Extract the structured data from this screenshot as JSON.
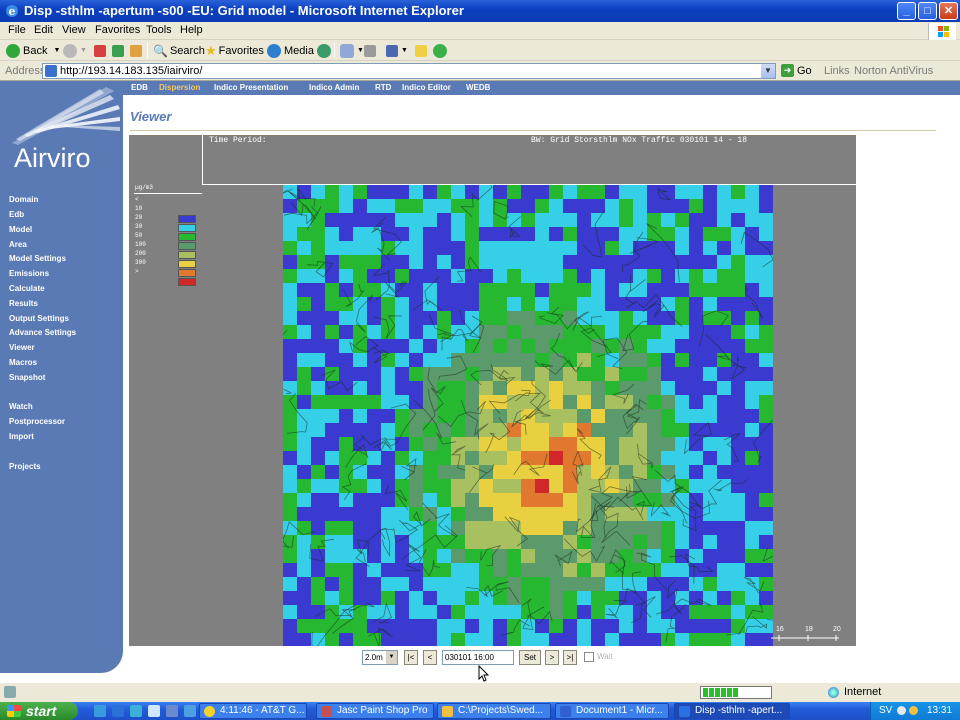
{
  "window": {
    "title": "Disp -sthlm -apertum -s00 -EU: Grid model - Microsoft Internet Explorer",
    "minimize": "_",
    "maximize": "□",
    "close": "✕"
  },
  "menu": [
    "File",
    "Edit",
    "View",
    "Favorites",
    "Tools",
    "Help"
  ],
  "toolbar": {
    "back": "Back",
    "search": "Search",
    "favorites": "Favorites",
    "media": "Media"
  },
  "address": {
    "label": "Address",
    "url": "http://193.14.183.135/iairviro/",
    "go": "Go",
    "links": "Links",
    "norton": "Norton AntiVirus"
  },
  "app": {
    "logo": "Airviro",
    "top_nav": [
      "EDB",
      "Dispersion",
      "Indico Presentation",
      "Indico Admin",
      "RTD",
      "Indico Editor",
      "WEDB"
    ],
    "active_top_nav": "Dispersion",
    "side_nav": [
      "Domain",
      "Edb",
      "Model",
      "Area",
      "Model Settings",
      "Emissions",
      "Calculate",
      "Results",
      "Output Settings",
      "Advance Settings",
      "Viewer",
      "Macros",
      "Snapshot",
      "Watch",
      "Postprocessor",
      "Import",
      "Projects"
    ],
    "page_title": "Viewer"
  },
  "viewer": {
    "time_period_label": "Time Period:",
    "bw_label": "BW: Grid Storsthlm NOx Traffic 030101 14 - 18",
    "legend": {
      "unit": "µg/m3",
      "entries": [
        {
          "label": "<",
          "color": null
        },
        {
          "label": "10",
          "color": "#3a3ad0"
        },
        {
          "label": "20",
          "color": "#35d0e8"
        },
        {
          "label": "30",
          "color": "#25b830"
        },
        {
          "label": "50",
          "color": "#5b9a6a"
        },
        {
          "label": "100",
          "color": "#a8c060"
        },
        {
          "label": "200",
          "color": "#e8d040"
        },
        {
          "label": "300",
          "color": "#e07830"
        },
        {
          "label": ">",
          "color": "#d02828"
        }
      ]
    },
    "scale_labels": [
      "16",
      "18",
      "20"
    ]
  },
  "controls": {
    "step": "2.0m",
    "first": "|<",
    "prev": "<",
    "time": "030101 16:00",
    "set": "Set",
    "next": ">",
    "last": ">|",
    "wait": "Wait"
  },
  "status": {
    "zone": "Internet"
  },
  "taskbar": {
    "start": "start",
    "tasks": [
      {
        "label": "4:11:46 - AT&T G...",
        "color": "#f2d22a"
      },
      {
        "label": "Jasc Paint Shop Pro",
        "color": "#c85050"
      },
      {
        "label": "C:\\Projects\\Swed...",
        "color": "#f0c040"
      },
      {
        "label": "Document1 - Micr...",
        "color": "#3060d0"
      },
      {
        "label": "Disp -sthlm -apert...",
        "color": "#2a70e0"
      }
    ],
    "lang": "SV",
    "clock": "13:31"
  }
}
